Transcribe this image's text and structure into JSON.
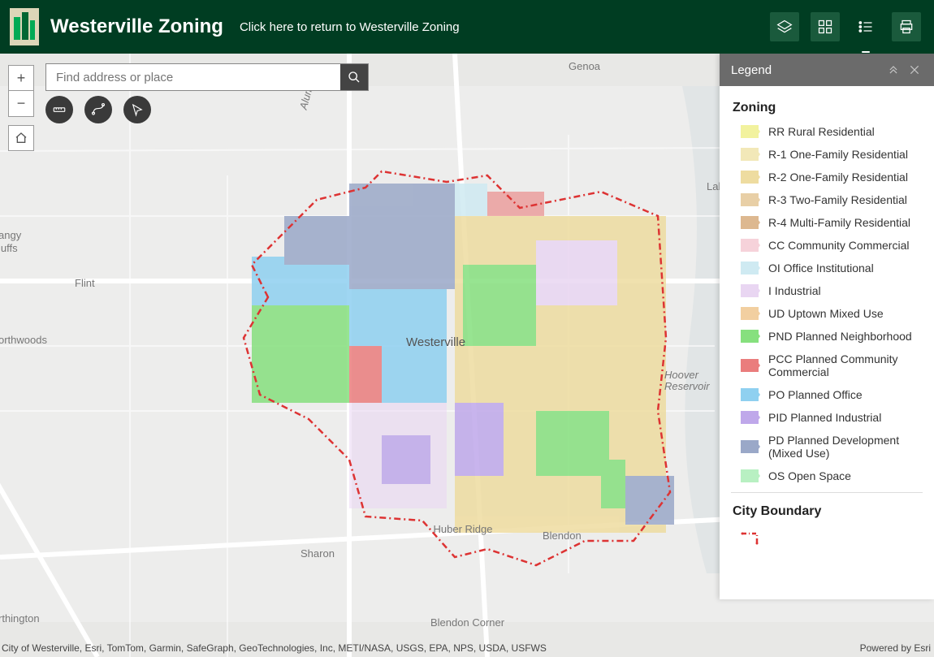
{
  "header": {
    "title": "Westerville Zoning",
    "subtitle": "Click here to return to Westerville Zoning",
    "tools": {
      "layers": "layers-icon",
      "basemap": "basemap-icon",
      "legend": "legend-icon",
      "print": "print-icon"
    }
  },
  "search": {
    "placeholder": "Find address or place"
  },
  "controls": {
    "zoom_in": "+",
    "zoom_out": "−",
    "home": "home"
  },
  "circle_tools": [
    "measure-icon",
    "route-icon",
    "select-icon"
  ],
  "attribution_left": "City of Westerville, Esri, TomTom, Garmin, SafeGraph, GeoTechnologies, Inc, METI/NASA, USGS, EPA, NPS, USDA, USFWS",
  "attribution_right": "Powered by Esri",
  "legend": {
    "panel_title": "Legend",
    "sections": [
      {
        "title": "Zoning",
        "items": [
          {
            "color": "#f2f29e",
            "label": "RR Rural Residential"
          },
          {
            "color": "#f2e8b8",
            "label": "R-1 One-Family Residential"
          },
          {
            "color": "#eedca0",
            "label": "R-2 One-Family Residential"
          },
          {
            "color": "#e8cfa6",
            "label": "R-3 Two-Family Residential"
          },
          {
            "color": "#ddb890",
            "label": "R-4 Multi-Family Residential"
          },
          {
            "color": "#f6d2da",
            "label": "CC Community Commercial"
          },
          {
            "color": "#cfeaf2",
            "label": "OI Office Institutional"
          },
          {
            "color": "#e9d6f2",
            "label": "I Industrial"
          },
          {
            "color": "#f2cfa0",
            "label": "UD Uptown Mixed Use"
          },
          {
            "color": "#86e07e",
            "label": "PND Planned Neighborhood"
          },
          {
            "color": "#ea7d7d",
            "label": "PCC Planned Community Commercial"
          },
          {
            "color": "#8fd0f0",
            "label": "PO Planned Office"
          },
          {
            "color": "#bfa8ea",
            "label": "PID Planned Industrial"
          },
          {
            "color": "#9aa8c8",
            "label": "PD Planned Development (Mixed Use)"
          },
          {
            "color": "#b8f0c2",
            "label": "OS Open Space"
          }
        ]
      },
      {
        "title": "City Boundary",
        "boundary": {
          "color": "#d33"
        }
      }
    ]
  },
  "map_labels": {
    "center": "Westerville",
    "genoa": "Genoa",
    "lak": "Lak",
    "flint": "Flint",
    "northwoods": "orthwoods",
    "tangy": "angy",
    "bluffs": "luffs",
    "sharon": "Sharon",
    "huber": "Huber Ridge",
    "blendon": "Blendon",
    "blendon_corner": "Blendon Corner",
    "hoover": "Hoover Reservoir",
    "arlington": "rthington",
    "alum": "Alum Cr"
  }
}
